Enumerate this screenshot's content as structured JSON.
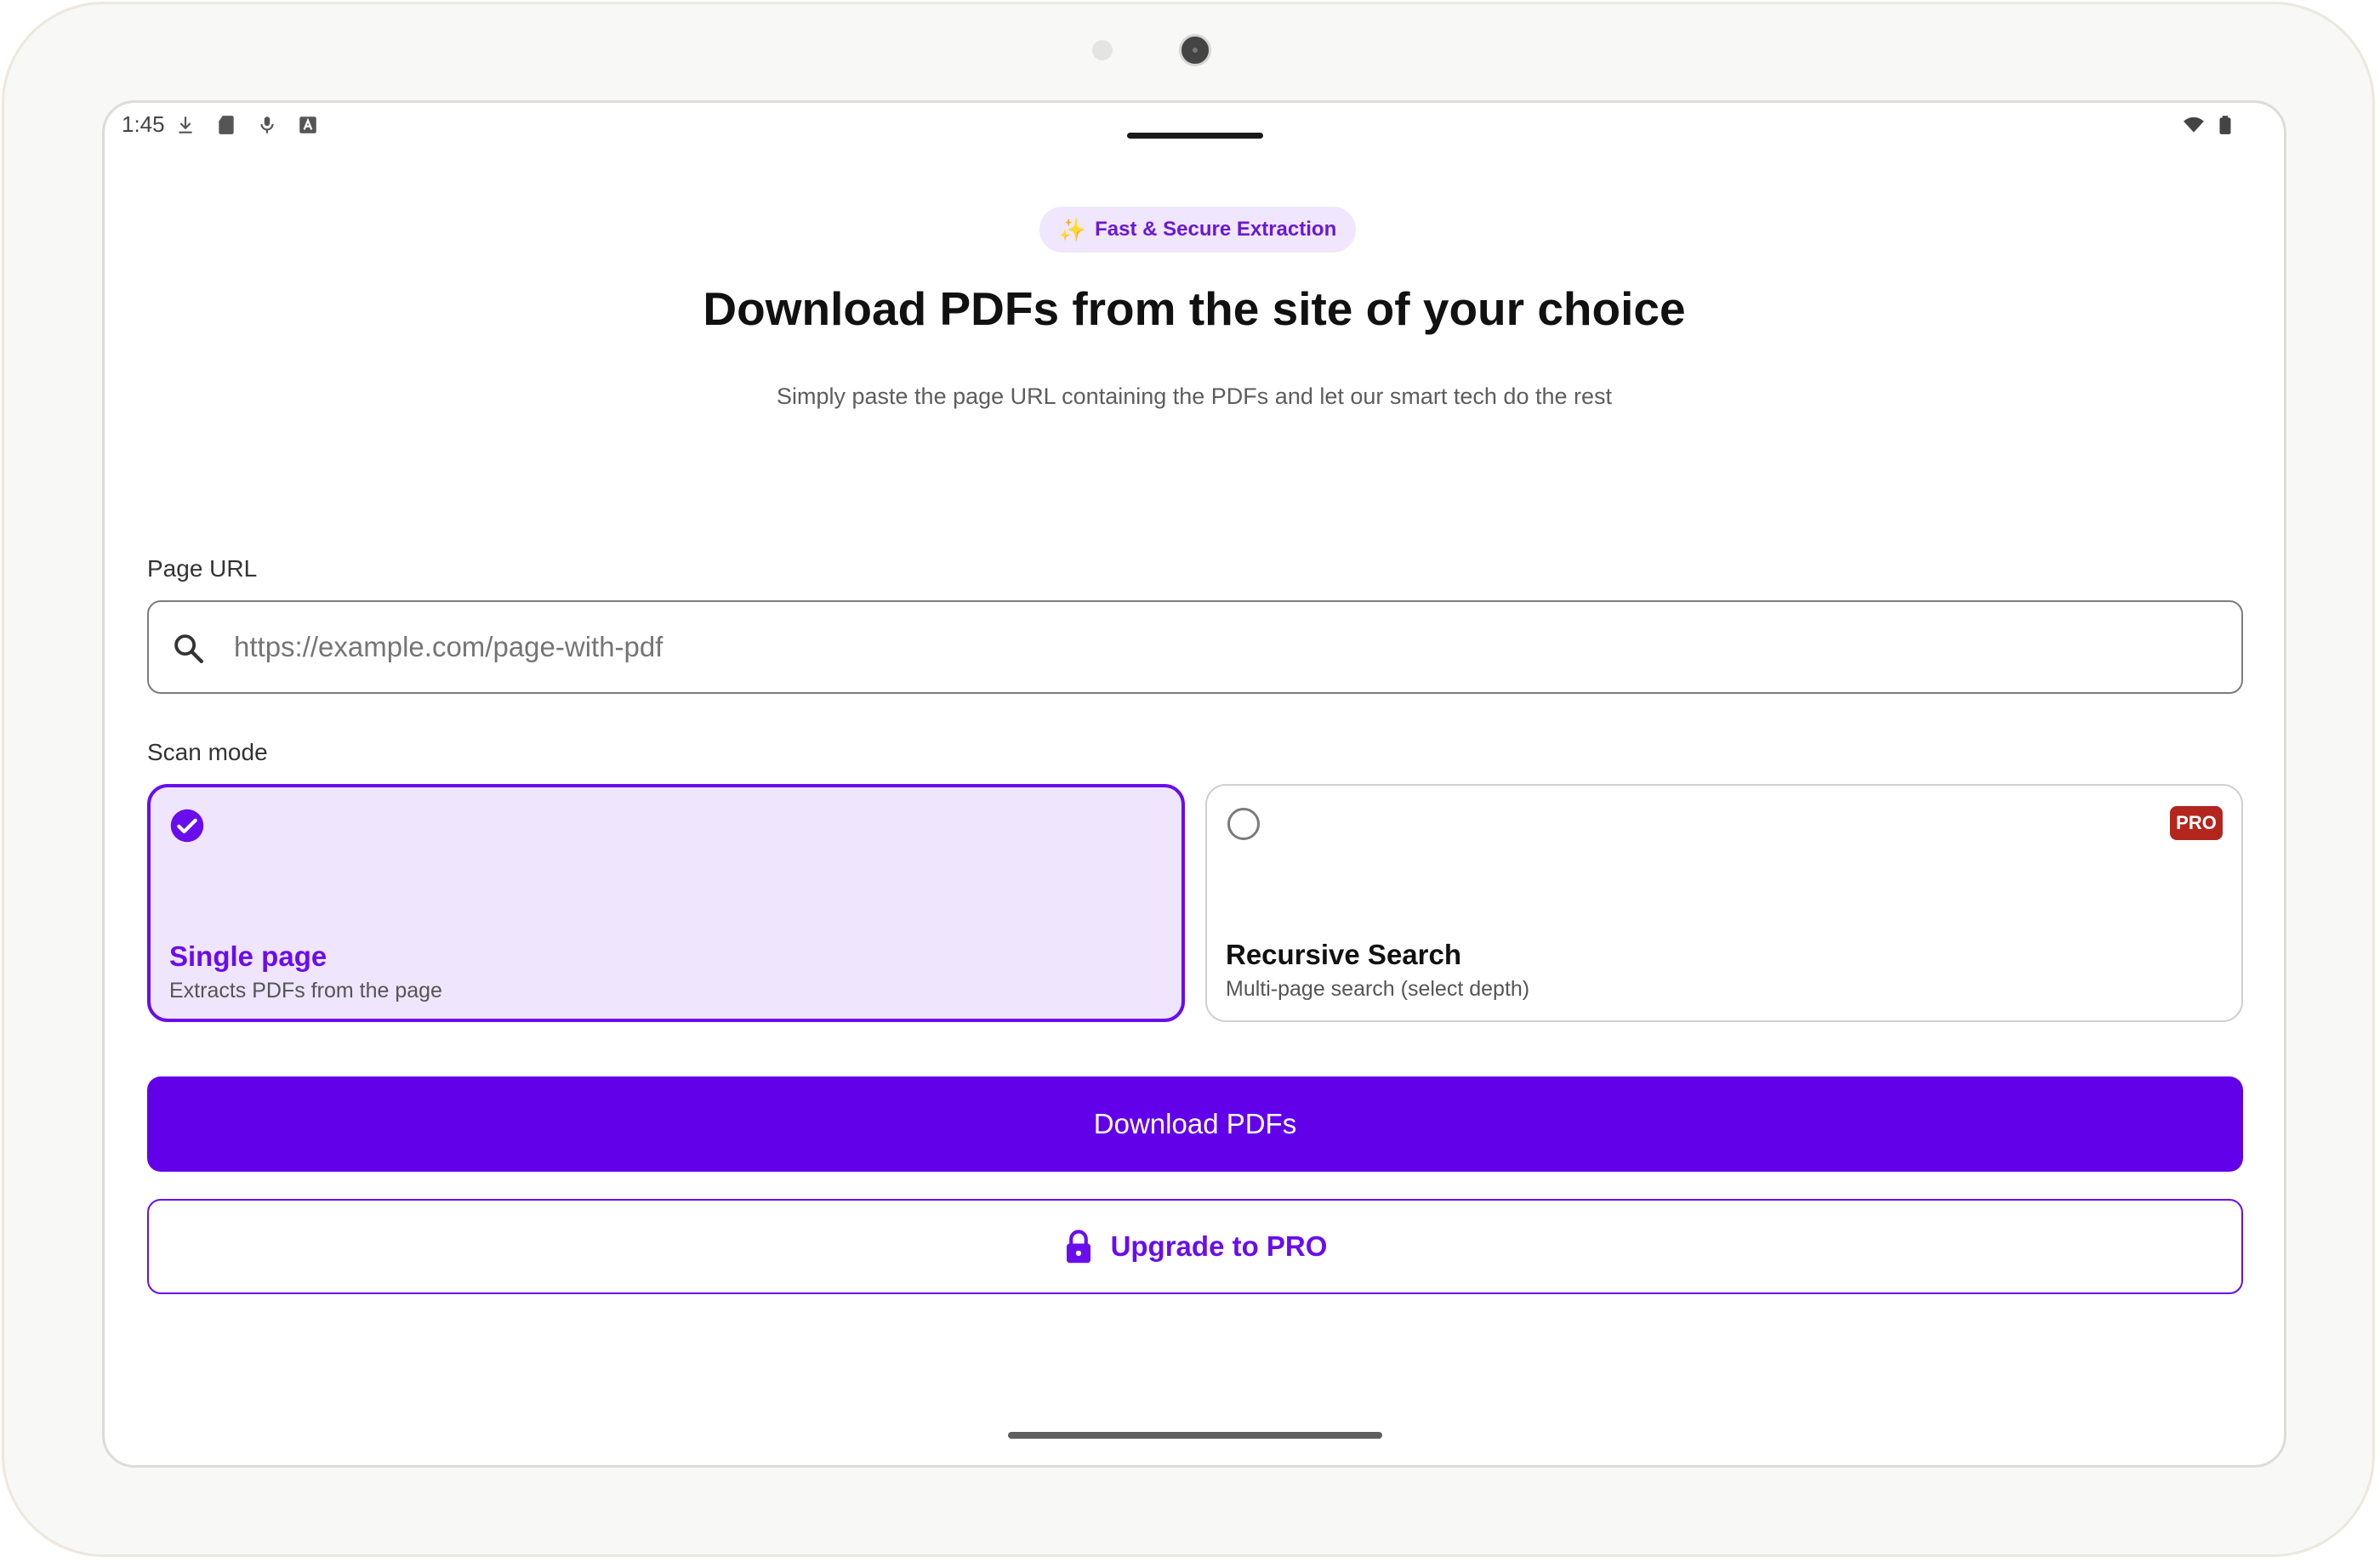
{
  "status_bar": {
    "time": "1:45",
    "left_icons": [
      "download-icon",
      "sd-card-icon",
      "microphone-icon",
      "font-icon"
    ],
    "right_icons": [
      "wifi-icon",
      "battery-icon"
    ]
  },
  "badge": {
    "icon": "✨",
    "label": "Fast & Secure Extraction"
  },
  "headline": "Download PDFs from the site of your choice",
  "subtitle": "Simply paste the page URL containing the PDFs and let our smart tech do the rest",
  "url_section": {
    "label": "Page URL",
    "placeholder": "https://example.com/page-with-pdf",
    "value": ""
  },
  "scan_mode": {
    "label": "Scan mode",
    "options": [
      {
        "title": "Single page",
        "description": "Extracts PDFs from the page",
        "selected": true
      },
      {
        "title": "Recursive Search",
        "description": "Multi-page search (select depth)",
        "selected": false,
        "tag": "PRO"
      }
    ]
  },
  "actions": {
    "primary_label": "Download PDFs",
    "secondary_label": "Upgrade to PRO"
  },
  "colors": {
    "accent": "#6200ea",
    "accent_light": "#efe5fc",
    "pro_tag": "#b3261e"
  }
}
